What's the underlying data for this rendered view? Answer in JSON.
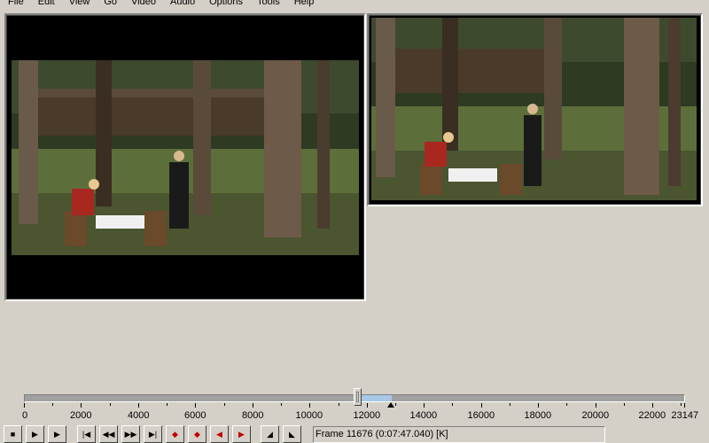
{
  "menu": [
    "File",
    "Edit",
    "View",
    "Go",
    "Video",
    "Audio",
    "Options",
    "Tools",
    "Help"
  ],
  "timeline": {
    "max_frame": 23147,
    "current_frame": 11676,
    "selection_start": 11676,
    "selection_end": 12850,
    "marker_frame": 12850,
    "tick_labels": [
      "0",
      "2000",
      "4000",
      "6000",
      "8000",
      "10000",
      "12000",
      "14000",
      "16000",
      "18000",
      "20000",
      "22000",
      "23147"
    ],
    "tick_values": [
      0,
      2000,
      4000,
      6000,
      8000,
      10000,
      12000,
      14000,
      16000,
      18000,
      20000,
      22000,
      23147
    ]
  },
  "toolbar": {
    "buttons": [
      {
        "name": "stop-button",
        "glyph": "■"
      },
      {
        "name": "play-input-button",
        "glyph": "▶"
      },
      {
        "name": "play-output-button",
        "glyph": "▶"
      },
      {
        "name": "go-start-button",
        "glyph": "|◀"
      },
      {
        "name": "step-back-button",
        "glyph": "◀◀"
      },
      {
        "name": "step-forward-button",
        "glyph": "▶▶"
      },
      {
        "name": "go-end-button",
        "glyph": "▶|"
      },
      {
        "name": "prev-keyframe-button",
        "glyph": "◆"
      },
      {
        "name": "next-keyframe-button",
        "glyph": "◆"
      },
      {
        "name": "prev-scene-button",
        "glyph": "◀"
      },
      {
        "name": "next-scene-button",
        "glyph": "▶"
      },
      {
        "name": "mark-in-button",
        "glyph": "◢"
      },
      {
        "name": "mark-out-button",
        "glyph": "◣"
      }
    ]
  },
  "status": "Frame 11676 (0:07:47.040) [K]",
  "colors": {
    "chrome": "#d4d0c8",
    "selection": "#a8c8e8",
    "pane_bg": "#000000"
  }
}
